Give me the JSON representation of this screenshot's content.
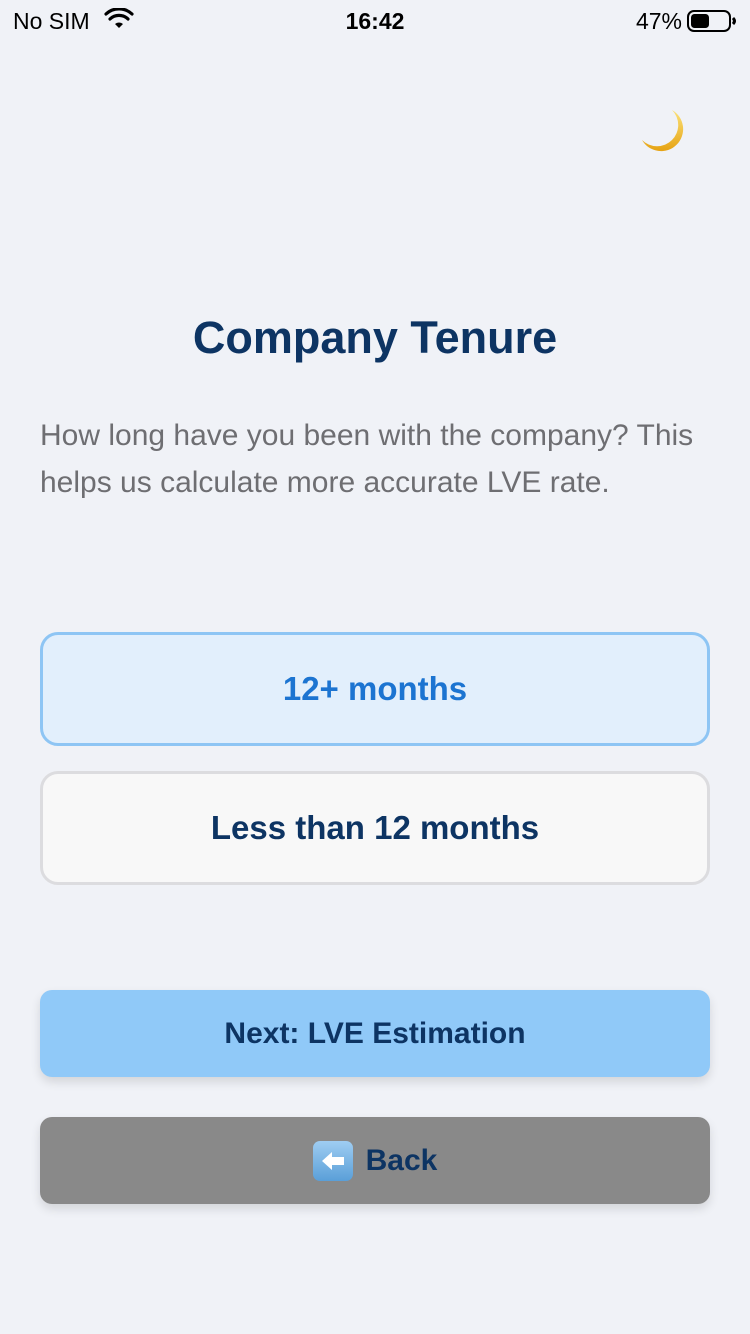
{
  "status_bar": {
    "carrier": "No SIM",
    "time": "16:42",
    "battery": "47%"
  },
  "theme_toggle": {
    "icon": "crescent-moon-icon"
  },
  "page": {
    "title": "Company Tenure",
    "description": "How long have you been with the company? This helps us calculate more accurate LVE rate."
  },
  "options": [
    {
      "label": "12+ months",
      "selected": true
    },
    {
      "label": "Less than 12 months",
      "selected": false
    }
  ],
  "buttons": {
    "next_label": "Next: LVE Estimation",
    "back_label": "Back",
    "back_icon": "left-arrow-icon"
  },
  "colors": {
    "background": "#f0f2f7",
    "title": "#0d3463",
    "selected_fill": "#e2effc",
    "selected_border": "#8ec5f4",
    "selected_text": "#1c74d1",
    "next_button": "#90c9f8",
    "back_button": "#898989"
  }
}
